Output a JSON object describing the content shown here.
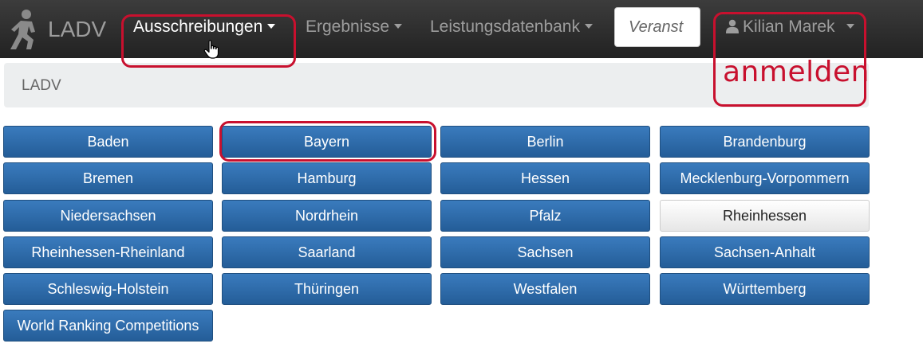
{
  "navbar": {
    "brand": "LADV",
    "items": [
      {
        "label": "Ausschreibungen"
      },
      {
        "label": "Ergebnisse"
      },
      {
        "label": "Leistungsdatenbank"
      }
    ],
    "search": {
      "placeholder": "Veranst",
      "value": ""
    },
    "user": {
      "name": "Kilian Marek"
    }
  },
  "breadcrumb": {
    "text": "LADV"
  },
  "annotation": {
    "text": "anmelden",
    "color": "#c8102e"
  },
  "regions": [
    {
      "label": "Baden"
    },
    {
      "label": "Bayern"
    },
    {
      "label": "Berlin"
    },
    {
      "label": "Brandenburg"
    },
    {
      "label": "Bremen"
    },
    {
      "label": "Hamburg"
    },
    {
      "label": "Hessen"
    },
    {
      "label": "Mecklenburg-Vorpommern"
    },
    {
      "label": "Niedersachsen"
    },
    {
      "label": "Nordrhein"
    },
    {
      "label": "Pfalz"
    },
    {
      "label": "Rheinhessen"
    },
    {
      "label": "Rheinhessen-Rheinland"
    },
    {
      "label": "Saarland"
    },
    {
      "label": "Sachsen"
    },
    {
      "label": "Sachsen-Anhalt"
    },
    {
      "label": "Schleswig-Holstein"
    },
    {
      "label": "Thüringen"
    },
    {
      "label": "Westfalen"
    },
    {
      "label": "Württemberg"
    },
    {
      "label": "World Ranking Competitions"
    }
  ],
  "colors": {
    "navbar": "#222222",
    "button": "#245d98",
    "highlight": "#c8102e"
  }
}
